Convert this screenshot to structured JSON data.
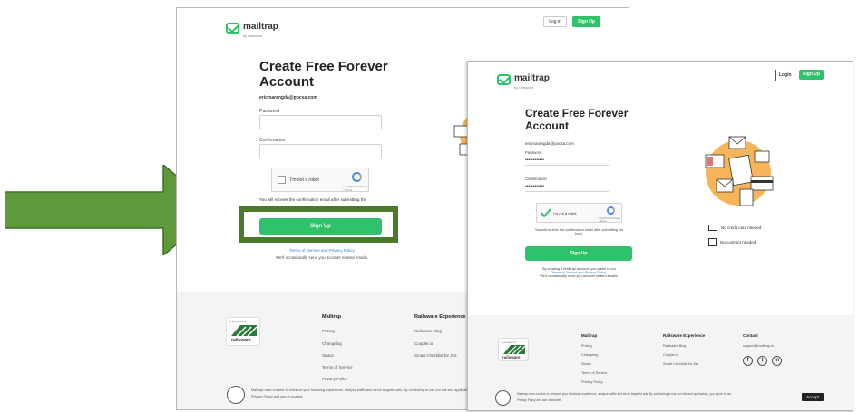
{
  "brand": {
    "name": "mailtrap",
    "sub": "by railsware"
  },
  "header": {
    "login": "Log in",
    "signup": "Sign Up"
  },
  "header2": {
    "login": "Login",
    "signup": "Sign Up"
  },
  "form": {
    "title_line1": "Create Free Forever",
    "title_line2": "Account",
    "email": "ericmarangda@pocsa.com",
    "password_label": "Password",
    "confirmation_label": "Confirmation",
    "password_dots": "••••••••••••",
    "captcha_text": "I'm not a robot",
    "captcha_footer": "reCAPTCHA Privacy - Terms",
    "confirm_note": "You will receive the confirmation email after submitting the",
    "confirm_note_2": "form.",
    "signup_button": "Sign Up",
    "terms_line1": "Terms of Service and Privacy Policy",
    "terms_line2": "We'll occasionally send you account related emails.",
    "agree_line1": "By creating a Mailtrap account, you agree to our",
    "agree_line2": "Terms of Service and Privacy Policy.",
    "agree_line3": "We'll occasionally send you account related emails."
  },
  "perks": {
    "card": "No credit card needed",
    "contract": "No contract needed"
  },
  "footer": {
    "badge_text": "a product of",
    "railsware": "railsware",
    "mailtrap_head": "Mailtrap",
    "mailtrap_items": [
      "Pricing",
      "Changelog",
      "Status",
      "Terms of Service",
      "Privacy Policy"
    ],
    "rw_head": "Railsware Experience",
    "rw_items": [
      "Railsware Blog",
      "Coupler.io",
      "Smart Checklist for Jira"
    ],
    "contact_head": "Contact",
    "contact_email": "support@mailtrap.io",
    "cookie_text": "Mailtrap uses cookies to enhance your browsing experience, analyze traffic and serve targeted ads. By continuing to use our site and application, you agree to our",
    "cookie_links": "Privacy Policy and use of cookies.",
    "accept": "Accept"
  },
  "colors": {
    "accent": "#2ec26a",
    "arrow": "#5e9a3b",
    "highlight": "#4b7a2b"
  }
}
